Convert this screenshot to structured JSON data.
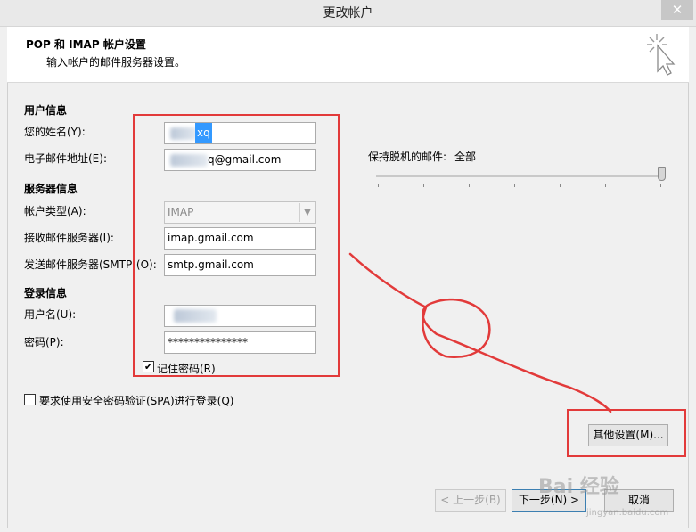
{
  "window": {
    "title": "更改帐户",
    "close_glyph": "✕"
  },
  "header": {
    "title": "POP 和 IMAP 帐户设置",
    "subtitle": "输入帐户的邮件服务器设置。"
  },
  "user_info": {
    "section": "用户信息",
    "name_label": "您的姓名(Y):",
    "name_value": "xq",
    "email_label": "电子邮件地址(E):",
    "email_value": "q@gmail.com"
  },
  "server_info": {
    "section": "服务器信息",
    "account_type_label": "帐户类型(A):",
    "account_type_value": "IMAP",
    "incoming_label": "接收邮件服务器(I):",
    "incoming_value": "imap.gmail.com",
    "outgoing_label": "发送邮件服务器(SMTP)(O):",
    "outgoing_value": "smtp.gmail.com"
  },
  "login_info": {
    "section": "登录信息",
    "username_label": "用户名(U):",
    "username_value": "",
    "password_label": "密码(P):",
    "password_value": "***************",
    "remember_label": "记住密码(R)",
    "remember_checked": true
  },
  "spa": {
    "label": "要求使用安全密码验证(SPA)进行登录(Q)",
    "checked": false
  },
  "offline": {
    "label": "保持脱机的邮件:",
    "value": "全部"
  },
  "buttons": {
    "more_settings": "其他设置(M)...",
    "back": "< 上一步(B)",
    "next": "下一步(N) >",
    "cancel": "取消"
  },
  "watermark": {
    "text": "Bai 经验",
    "sub": "jingyan.baidu.com"
  },
  "colors": {
    "annotation_red": "#e23a3a",
    "selection_blue": "#3399ff"
  }
}
